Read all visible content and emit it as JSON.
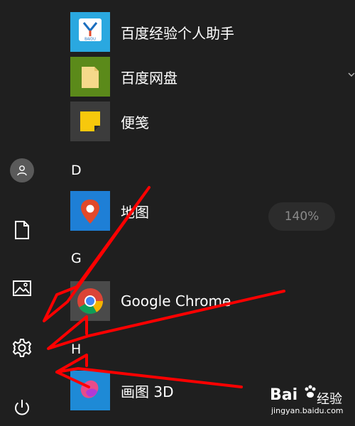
{
  "rail": {
    "items": [
      {
        "name": "user-account",
        "icon": "person-icon"
      },
      {
        "name": "documents",
        "icon": "document-icon"
      },
      {
        "name": "pictures",
        "icon": "pictures-icon"
      },
      {
        "name": "settings",
        "icon": "gear-icon"
      },
      {
        "name": "power",
        "icon": "power-icon"
      }
    ]
  },
  "apps": [
    {
      "label": "百度经验个人助手",
      "icon": "baidu-jingyan-assistant-icon",
      "color": "#2aa8e0"
    },
    {
      "label": "百度网盘",
      "icon": "baidu-netdisk-icon",
      "color": "#5b8a1a"
    },
    {
      "label": "便笺",
      "icon": "sticky-notes-icon",
      "color": "#3c3c3c"
    },
    {
      "label": "地图",
      "icon": "maps-icon",
      "color": "#1e7fd6"
    },
    {
      "label": "Google Chrome",
      "icon": "chrome-icon",
      "color": "#4a4a4a"
    },
    {
      "label": "画图 3D",
      "icon": "paint-3d-icon",
      "color": "#1e8ad6"
    }
  ],
  "letters": {
    "d": "D",
    "g": "G",
    "h": "H"
  },
  "baidu_tile_text": "BAIDU",
  "zoom": {
    "label": "140%"
  },
  "watermark": {
    "brand": "Bai",
    "jingyan": "经验",
    "url": "jingyan.baidu.com"
  },
  "annotation_color": "#ff0000"
}
